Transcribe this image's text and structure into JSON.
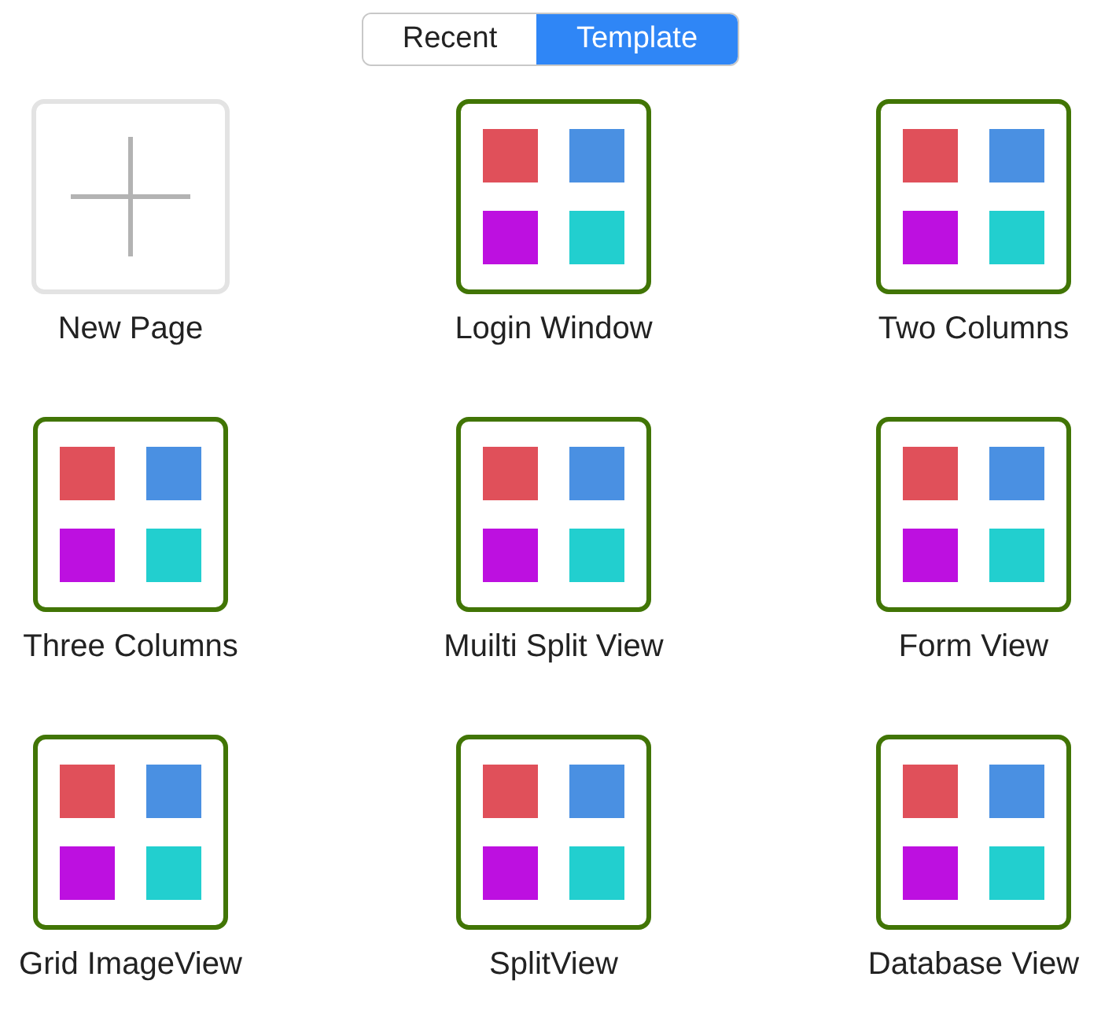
{
  "segments": [
    {
      "label": "Recent",
      "selected": false
    },
    {
      "label": "Template",
      "selected": true
    }
  ],
  "items": [
    {
      "label": "New Page",
      "kind": "new"
    },
    {
      "label": "Login Window",
      "kind": "template"
    },
    {
      "label": "Two Columns",
      "kind": "template"
    },
    {
      "label": "Three Columns",
      "kind": "template"
    },
    {
      "label": "Muilti Split View",
      "kind": "template"
    },
    {
      "label": "Form View",
      "kind": "template"
    },
    {
      "label": "Grid ImageView",
      "kind": "template"
    },
    {
      "label": "SplitView",
      "kind": "template"
    },
    {
      "label": "Database View",
      "kind": "template"
    }
  ]
}
